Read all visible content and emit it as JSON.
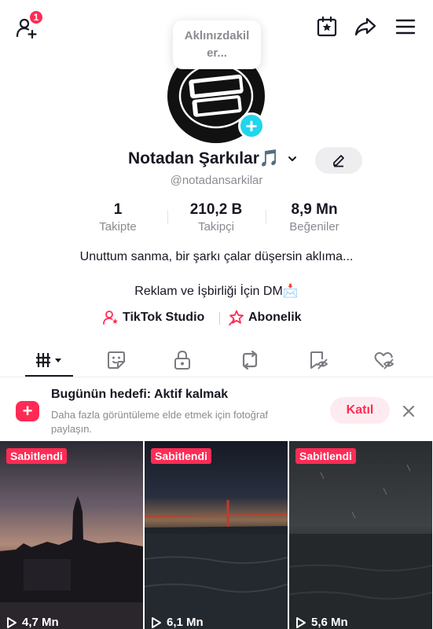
{
  "header": {
    "notification_count": "1",
    "icons": [
      "add-friend-icon",
      "calendar-star-icon",
      "share-icon",
      "menu-icon"
    ]
  },
  "thought_bubble": {
    "text_line1": "Aklınızdakil",
    "text_line2": "er..."
  },
  "profile": {
    "display_name": "Notadan Şarkılar🎵",
    "handle": "@notadansarkilar"
  },
  "stats": [
    {
      "value": "1",
      "label": "Takipte"
    },
    {
      "value": "210,2 B",
      "label": "Takipçi"
    },
    {
      "value": "8,9 Mn",
      "label": "Beğeniler"
    }
  ],
  "bio": {
    "line1": "Unuttum sanma, bir şarkı çalar düşersin aklıma...",
    "line2": "Reklam ve İşbirliği İçin DM📩"
  },
  "links": {
    "studio": "TikTok Studio",
    "subscription": "Abonelik"
  },
  "tabs": [
    "videos-grid-icon",
    "sticker-icon",
    "lock-icon",
    "repost-icon",
    "saved-icon",
    "liked-icon"
  ],
  "banner": {
    "title": "Bugünün hedefi: Aktif kalmak",
    "subtitle": "Daha fazla görüntüleme elde etmek için fotoğraf paylaşın.",
    "join_label": "Katıl"
  },
  "videos": [
    {
      "pinned_label": "Sabitlendi",
      "views": "4,7 Mn"
    },
    {
      "pinned_label": "Sabitlendi",
      "views": "6,1 Mn"
    },
    {
      "pinned_label": "Sabitlendi",
      "views": "5,6 Mn"
    }
  ],
  "colors": {
    "accent": "#fe2c55",
    "avatar_plus": "#20d5ec",
    "secondary_text": "#8a8b91"
  }
}
